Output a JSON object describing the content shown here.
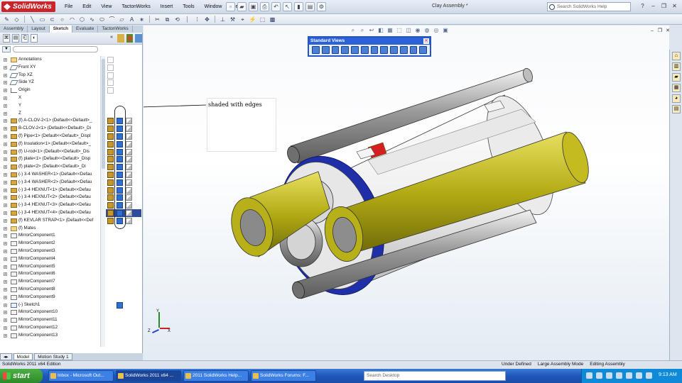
{
  "app": {
    "logo": "SolidWorks",
    "doc_title": "Clay Assembly *"
  },
  "menu": [
    "File",
    "Edit",
    "View",
    "TactonWorks",
    "Insert",
    "Tools",
    "Window",
    "Help"
  ],
  "search": {
    "placeholder": "Search SolidWorks Help"
  },
  "tabs": [
    "Assembly",
    "Layout",
    "Sketch",
    "Evaluate",
    "TactonWorks"
  ],
  "active_tab": "Sketch",
  "tree": [
    {
      "label": "Annotations",
      "icon": "folder"
    },
    {
      "label": "Front XY",
      "icon": "plane"
    },
    {
      "label": "Top XZ",
      "icon": "plane"
    },
    {
      "label": "Side YZ",
      "icon": "plane"
    },
    {
      "label": "Origin",
      "icon": "origin"
    },
    {
      "label": "X",
      "icon": "axis"
    },
    {
      "label": "Y",
      "icon": "axis"
    },
    {
      "label": "Z",
      "icon": "axis"
    },
    {
      "label": "(f) A-CLOV-2<1> (Default<<Default>_",
      "icon": "part"
    },
    {
      "label": "B-CLOV-2<1> (Default<<Default>_Di",
      "icon": "part"
    },
    {
      "label": "(f) Pipe<1> (Default<<Default>_Displ",
      "icon": "part"
    },
    {
      "label": "(f) Insulation<1> (Default<<Default>_",
      "icon": "part"
    },
    {
      "label": "(f) U-rod<1> (Default<<Default>_Dis",
      "icon": "part"
    },
    {
      "label": "(f) plate<1> (Default<<Default>_Disp",
      "icon": "part"
    },
    {
      "label": "(f) plate<2> (Default<<Default>_Di",
      "icon": "part"
    },
    {
      "label": "(-) 3-4 WASHER<1> (Default<<Defau",
      "icon": "part"
    },
    {
      "label": "(-) 3-4 WASHER<2> (Default<<Defau",
      "icon": "part"
    },
    {
      "label": "(-) 3-4 HEXNUT<1> (Default<<Defau",
      "icon": "part"
    },
    {
      "label": "(-) 3-4 HEXNUT<2> (Default<<Defau",
      "icon": "part"
    },
    {
      "label": "(-) 3-4 HEXNUT<3> (Default<<Defau",
      "icon": "part"
    },
    {
      "label": "(-) 3-4 HEXNUT<4> (Default<<Defau",
      "icon": "part"
    },
    {
      "label": "(f) KEVLAR STRAP<1> (Default<<Def",
      "icon": "part"
    },
    {
      "label": "(f) Mates",
      "icon": "folder"
    },
    {
      "label": "MirrorComponent1",
      "icon": "mirror"
    },
    {
      "label": "MirrorComponent2",
      "icon": "mirror"
    },
    {
      "label": "MirrorComponent3",
      "icon": "mirror"
    },
    {
      "label": "MirrorComponent4",
      "icon": "mirror"
    },
    {
      "label": "MirrorComponent5",
      "icon": "mirror"
    },
    {
      "label": "MirrorComponent6",
      "icon": "mirror"
    },
    {
      "label": "MirrorComponent7",
      "icon": "mirror"
    },
    {
      "label": "MirrorComponent8",
      "icon": "mirror"
    },
    {
      "label": "MirrorComponent9",
      "icon": "mirror"
    },
    {
      "label": "(-) Sketch1",
      "icon": "sketch"
    },
    {
      "label": "MirrorComponent10",
      "icon": "mirror"
    },
    {
      "label": "MirrorComponent11",
      "icon": "mirror"
    },
    {
      "label": "MirrorComponent12",
      "icon": "mirror"
    },
    {
      "label": "MirrorComponent13",
      "icon": "mirror"
    }
  ],
  "bottom_tabs": [
    "Model",
    "Motion Study 1"
  ],
  "standard_views": {
    "title": "Standard Views"
  },
  "annotation_text": "shaded with edges",
  "triad": {
    "x": "X",
    "y": "Y",
    "z": "Z"
  },
  "status": {
    "left": "SolidWorks 2011 x64 Edition",
    "right": [
      "Under Defined",
      "Large Assembly Mode",
      "Editing Assembly"
    ]
  },
  "taskbar": {
    "start": "start",
    "tasks": [
      "Inbox - Microsoft Out...",
      "SolidWorks 2011 x64 ...",
      "2011 SolidWorks Help...",
      "SolidWorks Forums: F..."
    ],
    "search_placeholder": "Search Desktop",
    "clock": "9:13 AM"
  },
  "colors": {
    "accent": "#2b62d8",
    "brand": "#c8262b",
    "rod_yellow": "#c8c020",
    "ring_blue": "#1f2fa8"
  }
}
